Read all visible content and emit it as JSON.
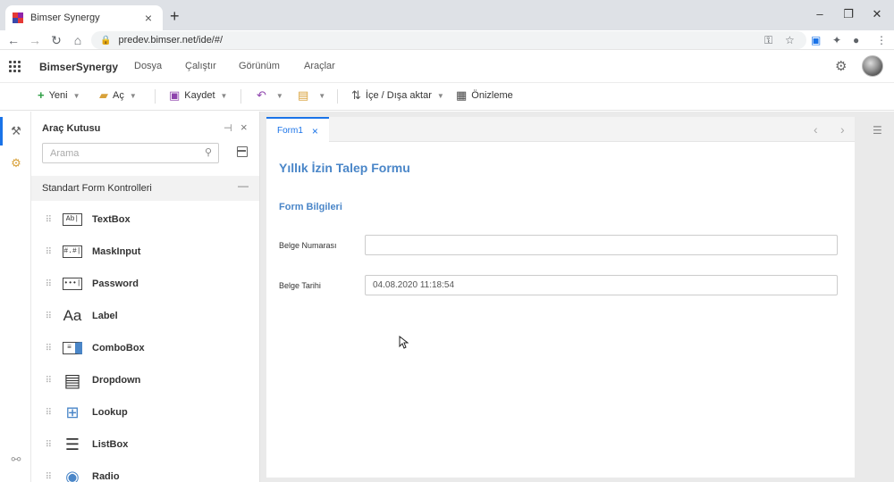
{
  "browser": {
    "tab_title": "Bimser Synergy",
    "tab_close": "×",
    "new_tab": "+",
    "url": "predev.bimser.net/ide/#/",
    "win_min": "–",
    "win_restore": "❐",
    "win_close": "✕"
  },
  "app": {
    "brand": "BimserSynergy",
    "menu": [
      "Dosya",
      "Çalıştır",
      "Görünüm",
      "Araçlar"
    ]
  },
  "toolbar": {
    "new_label": "Yeni",
    "open_label": "Aç",
    "save_label": "Kaydet",
    "import_export_label": "İçe / Dışa aktar",
    "preview_label": "Önizleme"
  },
  "toolbox": {
    "title": "Araç Kutusu",
    "search_placeholder": "Arama",
    "group_title": "Standart Form Kontrolleri",
    "group_toggle": "—",
    "controls": [
      {
        "name": "TextBox",
        "icon": "Ab|"
      },
      {
        "name": "MaskInput",
        "icon": "#.#|"
      },
      {
        "name": "Password",
        "icon": "•••|"
      },
      {
        "name": "Label",
        "icon": "Aa"
      },
      {
        "name": "ComboBox",
        "icon": "≡"
      },
      {
        "name": "Dropdown",
        "icon": "▤"
      },
      {
        "name": "Lookup",
        "icon": "⊞"
      },
      {
        "name": "ListBox",
        "icon": "☰"
      },
      {
        "name": "Radio",
        "icon": "◉"
      }
    ]
  },
  "document": {
    "tab_label": "Form1",
    "tab_close": "×",
    "form_title": "Yıllık İzin Talep Formu",
    "section_title": "Form Bilgileri",
    "fields": [
      {
        "label": "Belge Numarası",
        "value": ""
      },
      {
        "label": "Belge Tarihi",
        "value": "04.08.2020 11:18:54"
      }
    ]
  },
  "colors": {
    "accent": "#1a73e8",
    "form_heading": "#4a86c8"
  }
}
